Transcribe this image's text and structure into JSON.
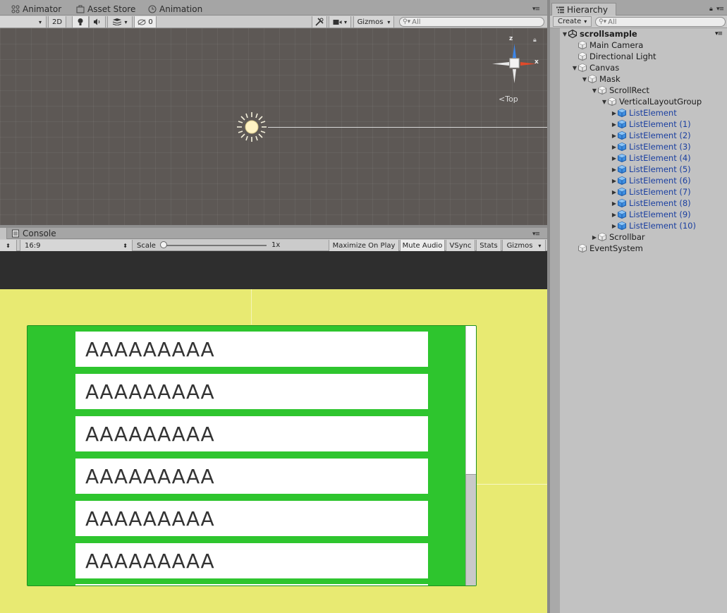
{
  "scene_tabs": {
    "animator": "Animator",
    "asset_store": "Asset Store",
    "animation": "Animation"
  },
  "scene_toolbar": {
    "mode_2d": "2D",
    "hidden_count": "0",
    "gizmos": "Gizmos",
    "search_placeholder": "All"
  },
  "gizmo": {
    "y_axis": "z",
    "x_axis": "x",
    "view": "Top"
  },
  "game_tabs": {
    "console": "Console"
  },
  "game_toolbar": {
    "aspect": "16:9",
    "scale_label": "Scale",
    "scale_value": "1x",
    "maximize": "Maximize On Play",
    "mute": "Mute Audio",
    "vsync": "VSync",
    "stats": "Stats",
    "gizmos": "Gizmos"
  },
  "game_view": {
    "list_items": [
      "AAAAAAAAA",
      "AAAAAAAAA",
      "AAAAAAAAA",
      "AAAAAAAAA",
      "AAAAAAAAA",
      "AAAAAAAAA"
    ]
  },
  "hierarchy": {
    "tab": "Hierarchy",
    "create": "Create",
    "search_placeholder": "All",
    "rows": [
      {
        "label": "scrollsample",
        "depth": 0,
        "arrow": "down",
        "kind": "scene"
      },
      {
        "label": "Main Camera",
        "depth": 1,
        "arrow": "none",
        "kind": "object"
      },
      {
        "label": "Directional Light",
        "depth": 1,
        "arrow": "none",
        "kind": "object"
      },
      {
        "label": "Canvas",
        "depth": 1,
        "arrow": "down",
        "kind": "object"
      },
      {
        "label": "Mask",
        "depth": 2,
        "arrow": "down",
        "kind": "object"
      },
      {
        "label": "ScrollRect",
        "depth": 3,
        "arrow": "down",
        "kind": "object"
      },
      {
        "label": "VerticalLayoutGroup",
        "depth": 4,
        "arrow": "down",
        "kind": "object"
      },
      {
        "label": "ListElement",
        "depth": 5,
        "arrow": "right",
        "kind": "prefab"
      },
      {
        "label": "ListElement (1)",
        "depth": 5,
        "arrow": "right",
        "kind": "prefab"
      },
      {
        "label": "ListElement (2)",
        "depth": 5,
        "arrow": "right",
        "kind": "prefab"
      },
      {
        "label": "ListElement (3)",
        "depth": 5,
        "arrow": "right",
        "kind": "prefab"
      },
      {
        "label": "ListElement (4)",
        "depth": 5,
        "arrow": "right",
        "kind": "prefab"
      },
      {
        "label": "ListElement (5)",
        "depth": 5,
        "arrow": "right",
        "kind": "prefab"
      },
      {
        "label": "ListElement (6)",
        "depth": 5,
        "arrow": "right",
        "kind": "prefab"
      },
      {
        "label": "ListElement (7)",
        "depth": 5,
        "arrow": "right",
        "kind": "prefab"
      },
      {
        "label": "ListElement (8)",
        "depth": 5,
        "arrow": "right",
        "kind": "prefab"
      },
      {
        "label": "ListElement (9)",
        "depth": 5,
        "arrow": "right",
        "kind": "prefab"
      },
      {
        "label": "ListElement (10)",
        "depth": 5,
        "arrow": "right",
        "kind": "prefab"
      },
      {
        "label": "Scrollbar",
        "depth": 3,
        "arrow": "right",
        "kind": "object"
      },
      {
        "label": "EventSystem",
        "depth": 1,
        "arrow": "none",
        "kind": "object"
      }
    ]
  },
  "colors": {
    "canvas_bg": "#e8ea72",
    "panel": "#2ec52e",
    "prefab_text": "#1a3fa0",
    "scene_bg": "#5d5855"
  }
}
